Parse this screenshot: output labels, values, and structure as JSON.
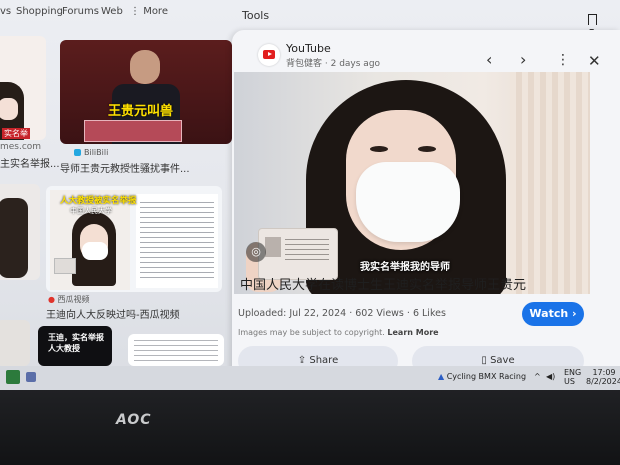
{
  "top_tabs": [
    "vs",
    "Shopping",
    "Forums",
    "Web",
    "More"
  ],
  "tools_label": "Tools",
  "save_top_label": "Save",
  "grid": {
    "tile1": {
      "badge": "实名举",
      "cap1": "mes.com",
      "cap2": "主实名举报..."
    },
    "tile2": {
      "overlay": "王贵元叫兽",
      "source": "BiliBili",
      "caption": "导师王贵元教授性骚扰事件..."
    },
    "tile3": {
      "overlay_top": "人大教授被实名举报",
      "overlay_sub": "中国人民大学",
      "source": "西瓜视频",
      "caption": "王迪向人大反映过吗-西瓜视频"
    },
    "tile4": {
      "overlay": "王迪，实名举报 人大教授"
    }
  },
  "panel": {
    "site": "YouTube",
    "channel": "背包健客",
    "age": "2 days ago",
    "video_subtitle": "我实名举报我的导师",
    "title": "中国人民大学在读博士生王迪实名举报导师王贵元",
    "uploaded": "Uploaded: Jul 22, 2024",
    "views": "602 Views",
    "likes": "6 Likes",
    "copyright_text": "Images may be subject to copyright.",
    "learn_more": "Learn More",
    "watch_label": "Watch",
    "share_label": "Share",
    "save_label": "Save"
  },
  "taskbar": {
    "now_playing": "Cycling BMX Racing",
    "lang": "ENG",
    "region": "US",
    "time": "17:09",
    "date": "8/2/2024"
  },
  "monitor_brand": "AOC"
}
